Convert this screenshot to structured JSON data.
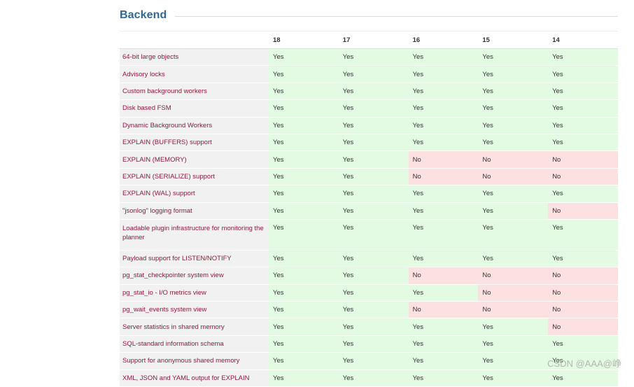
{
  "section": {
    "title": "Backend"
  },
  "versions": [
    "18",
    "17",
    "16",
    "15",
    "14"
  ],
  "colors": {
    "yes_bg": "#e2fbe2",
    "no_bg": "#fde0e0",
    "feature_text": "#8e1b3b",
    "title": "#336791"
  },
  "rows": [
    {
      "feature": "64-bit large objects",
      "values": [
        "Yes",
        "Yes",
        "Yes",
        "Yes",
        "Yes"
      ]
    },
    {
      "feature": "Advisory locks",
      "values": [
        "Yes",
        "Yes",
        "Yes",
        "Yes",
        "Yes"
      ]
    },
    {
      "feature": "Custom background workers",
      "values": [
        "Yes",
        "Yes",
        "Yes",
        "Yes",
        "Yes"
      ]
    },
    {
      "feature": "Disk based FSM",
      "values": [
        "Yes",
        "Yes",
        "Yes",
        "Yes",
        "Yes"
      ]
    },
    {
      "feature": "Dynamic Background Workers",
      "values": [
        "Yes",
        "Yes",
        "Yes",
        "Yes",
        "Yes"
      ]
    },
    {
      "feature": "EXPLAIN (BUFFERS) support",
      "values": [
        "Yes",
        "Yes",
        "Yes",
        "Yes",
        "Yes"
      ]
    },
    {
      "feature": "EXPLAIN (MEMORY)",
      "values": [
        "Yes",
        "Yes",
        "No",
        "No",
        "No"
      ]
    },
    {
      "feature": "EXPLAIN (SERIALIZE) support",
      "values": [
        "Yes",
        "Yes",
        "No",
        "No",
        "No"
      ]
    },
    {
      "feature": "EXPLAIN (WAL) support",
      "values": [
        "Yes",
        "Yes",
        "Yes",
        "Yes",
        "Yes"
      ]
    },
    {
      "feature": "\"jsonlog\" logging format",
      "values": [
        "Yes",
        "Yes",
        "Yes",
        "Yes",
        "No"
      ]
    },
    {
      "feature": "Loadable plugin infrastructure for monitoring the planner",
      "values": [
        "Yes",
        "Yes",
        "Yes",
        "Yes",
        "Yes"
      ],
      "tall": true
    },
    {
      "feature": "Payload support for LISTEN/NOTIFY",
      "values": [
        "Yes",
        "Yes",
        "Yes",
        "Yes",
        "Yes"
      ]
    },
    {
      "feature": "pg_stat_checkpointer system view",
      "values": [
        "Yes",
        "Yes",
        "No",
        "No",
        "No"
      ]
    },
    {
      "feature": "pg_stat_io - I/O metrics view",
      "values": [
        "Yes",
        "Yes",
        "Yes",
        "No",
        "No"
      ]
    },
    {
      "feature": "pg_wait_events system view",
      "values": [
        "Yes",
        "Yes",
        "No",
        "No",
        "No"
      ]
    },
    {
      "feature": "Server statistics in shared memory",
      "values": [
        "Yes",
        "Yes",
        "Yes",
        "Yes",
        "No"
      ]
    },
    {
      "feature": "SQL-standard information schema",
      "values": [
        "Yes",
        "Yes",
        "Yes",
        "Yes",
        "Yes"
      ]
    },
    {
      "feature": "Support for anonymous shared memory",
      "values": [
        "Yes",
        "Yes",
        "Yes",
        "Yes",
        "Yes"
      ]
    },
    {
      "feature": "XML, JSON and YAML output for EXPLAIN",
      "values": [
        "Yes",
        "Yes",
        "Yes",
        "Yes",
        "Yes"
      ]
    }
  ],
  "watermark": "CSDN @AAA@峥"
}
